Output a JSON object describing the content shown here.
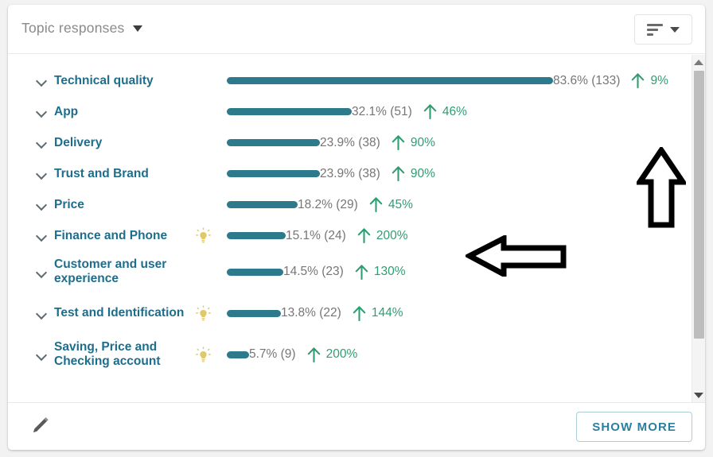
{
  "header": {
    "dropdown_label": "Topic responses",
    "sort_button_name": "sort-button"
  },
  "colors": {
    "bar": "#2c7a8c",
    "topic_label": "#1c6e8c",
    "percent_text": "#767676",
    "trend_green": "#2e9e72",
    "bulb_yellow": "#e0c96a",
    "card_bg": "#ffffff",
    "page_bg": "#f2f2f2"
  },
  "chart_data": {
    "type": "bar",
    "title": "Topic responses",
    "xlabel": "",
    "ylabel": "",
    "categories": [
      "Technical quality",
      "App",
      "Delivery",
      "Trust and Brand",
      "Price",
      "Finance and Phone",
      "Customer and user experience",
      "Test and Identification",
      "Saving, Price and Checking account"
    ],
    "values": [
      83.6,
      32.1,
      23.9,
      23.9,
      18.2,
      15.1,
      14.5,
      13.8,
      5.7
    ],
    "counts": [
      133,
      51,
      38,
      38,
      29,
      24,
      23,
      22,
      9
    ],
    "trend_values": [
      9,
      46,
      90,
      90,
      45,
      200,
      130,
      144,
      200
    ],
    "trend_direction": [
      "up",
      "up",
      "up",
      "up",
      "up",
      "up",
      "up",
      "up",
      "up"
    ],
    "xlim": [
      0,
      100
    ]
  },
  "rows": [
    {
      "label": "Technical quality",
      "percent": "83.6%",
      "count": "(133)",
      "percent_label": "83.6% (133)",
      "trend": "9%",
      "value": 83.6,
      "bulb": false,
      "tall": false
    },
    {
      "label": "App",
      "percent": "32.1%",
      "count": "(51)",
      "percent_label": "32.1% (51)",
      "trend": "46%",
      "value": 32.1,
      "bulb": false,
      "tall": false
    },
    {
      "label": "Delivery",
      "percent": "23.9%",
      "count": "(38)",
      "percent_label": "23.9% (38)",
      "trend": "90%",
      "value": 23.9,
      "bulb": false,
      "tall": false
    },
    {
      "label": "Trust and Brand",
      "percent": "23.9%",
      "count": "(38)",
      "percent_label": "23.9% (38)",
      "trend": "90%",
      "value": 23.9,
      "bulb": false,
      "tall": false
    },
    {
      "label": "Price",
      "percent": "18.2%",
      "count": "(29)",
      "percent_label": "18.2% (29)",
      "trend": "45%",
      "value": 18.2,
      "bulb": false,
      "tall": false
    },
    {
      "label": "Finance and Phone",
      "percent": "15.1%",
      "count": "(24)",
      "percent_label": "15.1% (24)",
      "trend": "200%",
      "value": 15.1,
      "bulb": true,
      "tall": false
    },
    {
      "label": "Customer and user experience",
      "percent": "14.5%",
      "count": "(23)",
      "percent_label": "14.5% (23)",
      "trend": "130%",
      "value": 14.5,
      "bulb": false,
      "tall": true
    },
    {
      "label": "Test and Identification",
      "percent": "13.8%",
      "count": "(22)",
      "percent_label": "13.8% (22)",
      "trend": "144%",
      "value": 13.8,
      "bulb": true,
      "tall": true
    },
    {
      "label": "Saving, Price and Checking account",
      "percent": "5.7%",
      "count": "(9)",
      "percent_label": "5.7% (9)",
      "trend": "200%",
      "value": 5.7,
      "bulb": true,
      "tall": true
    }
  ],
  "footer": {
    "show_more_label": "SHOW MORE",
    "edit_icon": "pencil-icon"
  },
  "annotations": [
    {
      "name": "up-arrow-annotation",
      "direction": "up"
    },
    {
      "name": "left-arrow-annotation",
      "direction": "left"
    }
  ]
}
